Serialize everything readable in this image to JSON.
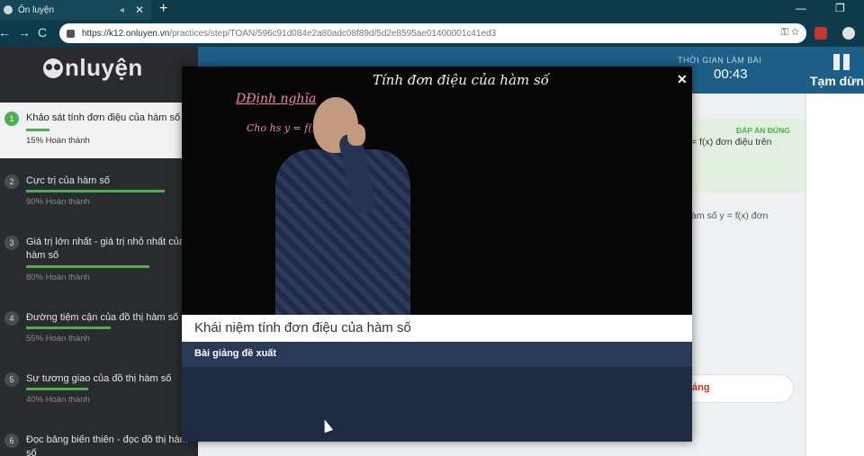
{
  "browser": {
    "tab_title": "Ôn luyện",
    "url_host": "https://k12.onluyen.vn",
    "url_path": "/practices/step/TOAN/596c91d084e2a80adc08f89d/5d2e8595ae01400001c41ed3",
    "ext_badge": "4"
  },
  "sidebar": {
    "logo_text": "nluyện",
    "lessons": [
      {
        "num": "1",
        "title": "Khảo sát tính đơn điệu của hàm số",
        "percent": "15% Hoàn thành",
        "progress": 0.15
      },
      {
        "num": "2",
        "title": "Cực trị của hàm số",
        "percent": "90% Hoàn thành",
        "progress": 0.9
      },
      {
        "num": "3",
        "title": "Giá trị lớn nhất - giá trị nhỏ nhất của hàm số",
        "percent": "80% Hoàn thành",
        "progress": 0.8
      },
      {
        "num": "4",
        "title": "Đường tiệm cận của đồ thị hàm số",
        "percent": "55% Hoàn thành",
        "progress": 0.55
      },
      {
        "num": "5",
        "title": "Sự tương giao của đồ thị hàm số",
        "percent": "40% Hoàn thành",
        "progress": 0.4
      },
      {
        "num": "6",
        "title": "Đọc bảng biến thiên - đọc đồ thị hàm số",
        "percent": "",
        "progress": 0
      }
    ]
  },
  "header": {
    "time_label": "THỜI GIAN LÀM BÀI",
    "time_value": "00:43",
    "pause_label": "Tạm dừn"
  },
  "content": {
    "answer_label": "ĐÁP ÁN ĐÚNG",
    "answer_line1": "= f(x) đơn điệu trên",
    "question_frag": "àm số y = f(x) đơn",
    "hint_label": "iảng"
  },
  "modal": {
    "board_title": "Tính đơn điệu của hàm số",
    "board_def": "DĐịnh nghĩa",
    "board_line": "Cho hs y = f(x)",
    "video_title": "Khái niệm tính đơn điệu của hàm số",
    "suggested_label": "Bài giảng đề xuất"
  },
  "colors": {
    "accent_green": "#4caf50",
    "header_blue": "#1e5f8a",
    "modal_bg": "#1d2b43"
  }
}
